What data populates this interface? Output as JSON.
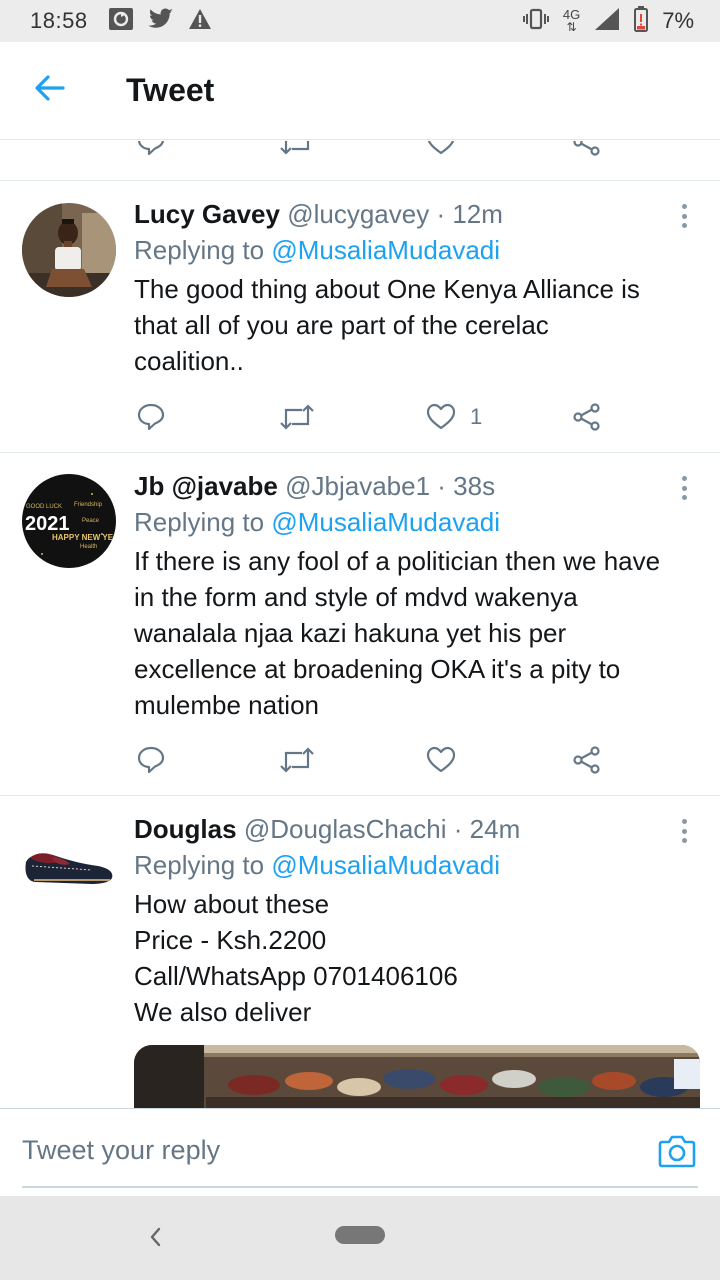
{
  "status_bar": {
    "time": "18:58",
    "left_icons": [
      "sync-icon",
      "twitter-icon",
      "alert-icon"
    ],
    "network": "4G",
    "battery": "7%",
    "right_icons": [
      "vibrate-icon",
      "signal-icon",
      "battery-icon"
    ]
  },
  "app_bar": {
    "title": "Tweet",
    "back_icon": "back-arrow-icon"
  },
  "tweets": [
    {
      "name": "Lucy Gavey",
      "handle": "@lucygavey",
      "time": "· 12m",
      "replying_prefix": "Replying to",
      "replying_to": "@MusaliaMudavadi",
      "text": "The good thing about One Kenya Alliance is\nthat all of you are part of the cerelac\ncoalition..",
      "likes": "1"
    },
    {
      "name": "Jb @javabe",
      "handle": "@Jbjavabe1",
      "time": "· 38s",
      "replying_prefix": "Replying to",
      "replying_to": "@MusaliaMudavadi",
      "text": "If there is any fool of a politician then we have\nin the form and style of mdvd wakenya\nwanalala njaa  kazi hakuna yet his per\nexcellence at broadening OKA it's a pity to\nmulembe nation",
      "likes": "",
      "avatar_text": "2021",
      "avatar_words": [
        "GOOD LUCK",
        "HAPPY NEW YEAR",
        "Friendship",
        "Peace",
        "Health"
      ]
    },
    {
      "name": "Douglas",
      "handle": "@DouglasChachi",
      "time": "· 24m",
      "replying_prefix": "Replying to",
      "replying_to": "@MusaliaMudavadi",
      "text": "How about these\nPrice - Ksh.2200\nCall/WhatsApp 0701406106\nWe also deliver",
      "likes": ""
    }
  ],
  "composer": {
    "placeholder": "Tweet your reply",
    "camera_icon": "camera-icon"
  },
  "colors": {
    "accent": "#1da1f2",
    "secondary_text": "#657786",
    "primary_text": "#14171a",
    "divider": "#e1e8ed"
  }
}
